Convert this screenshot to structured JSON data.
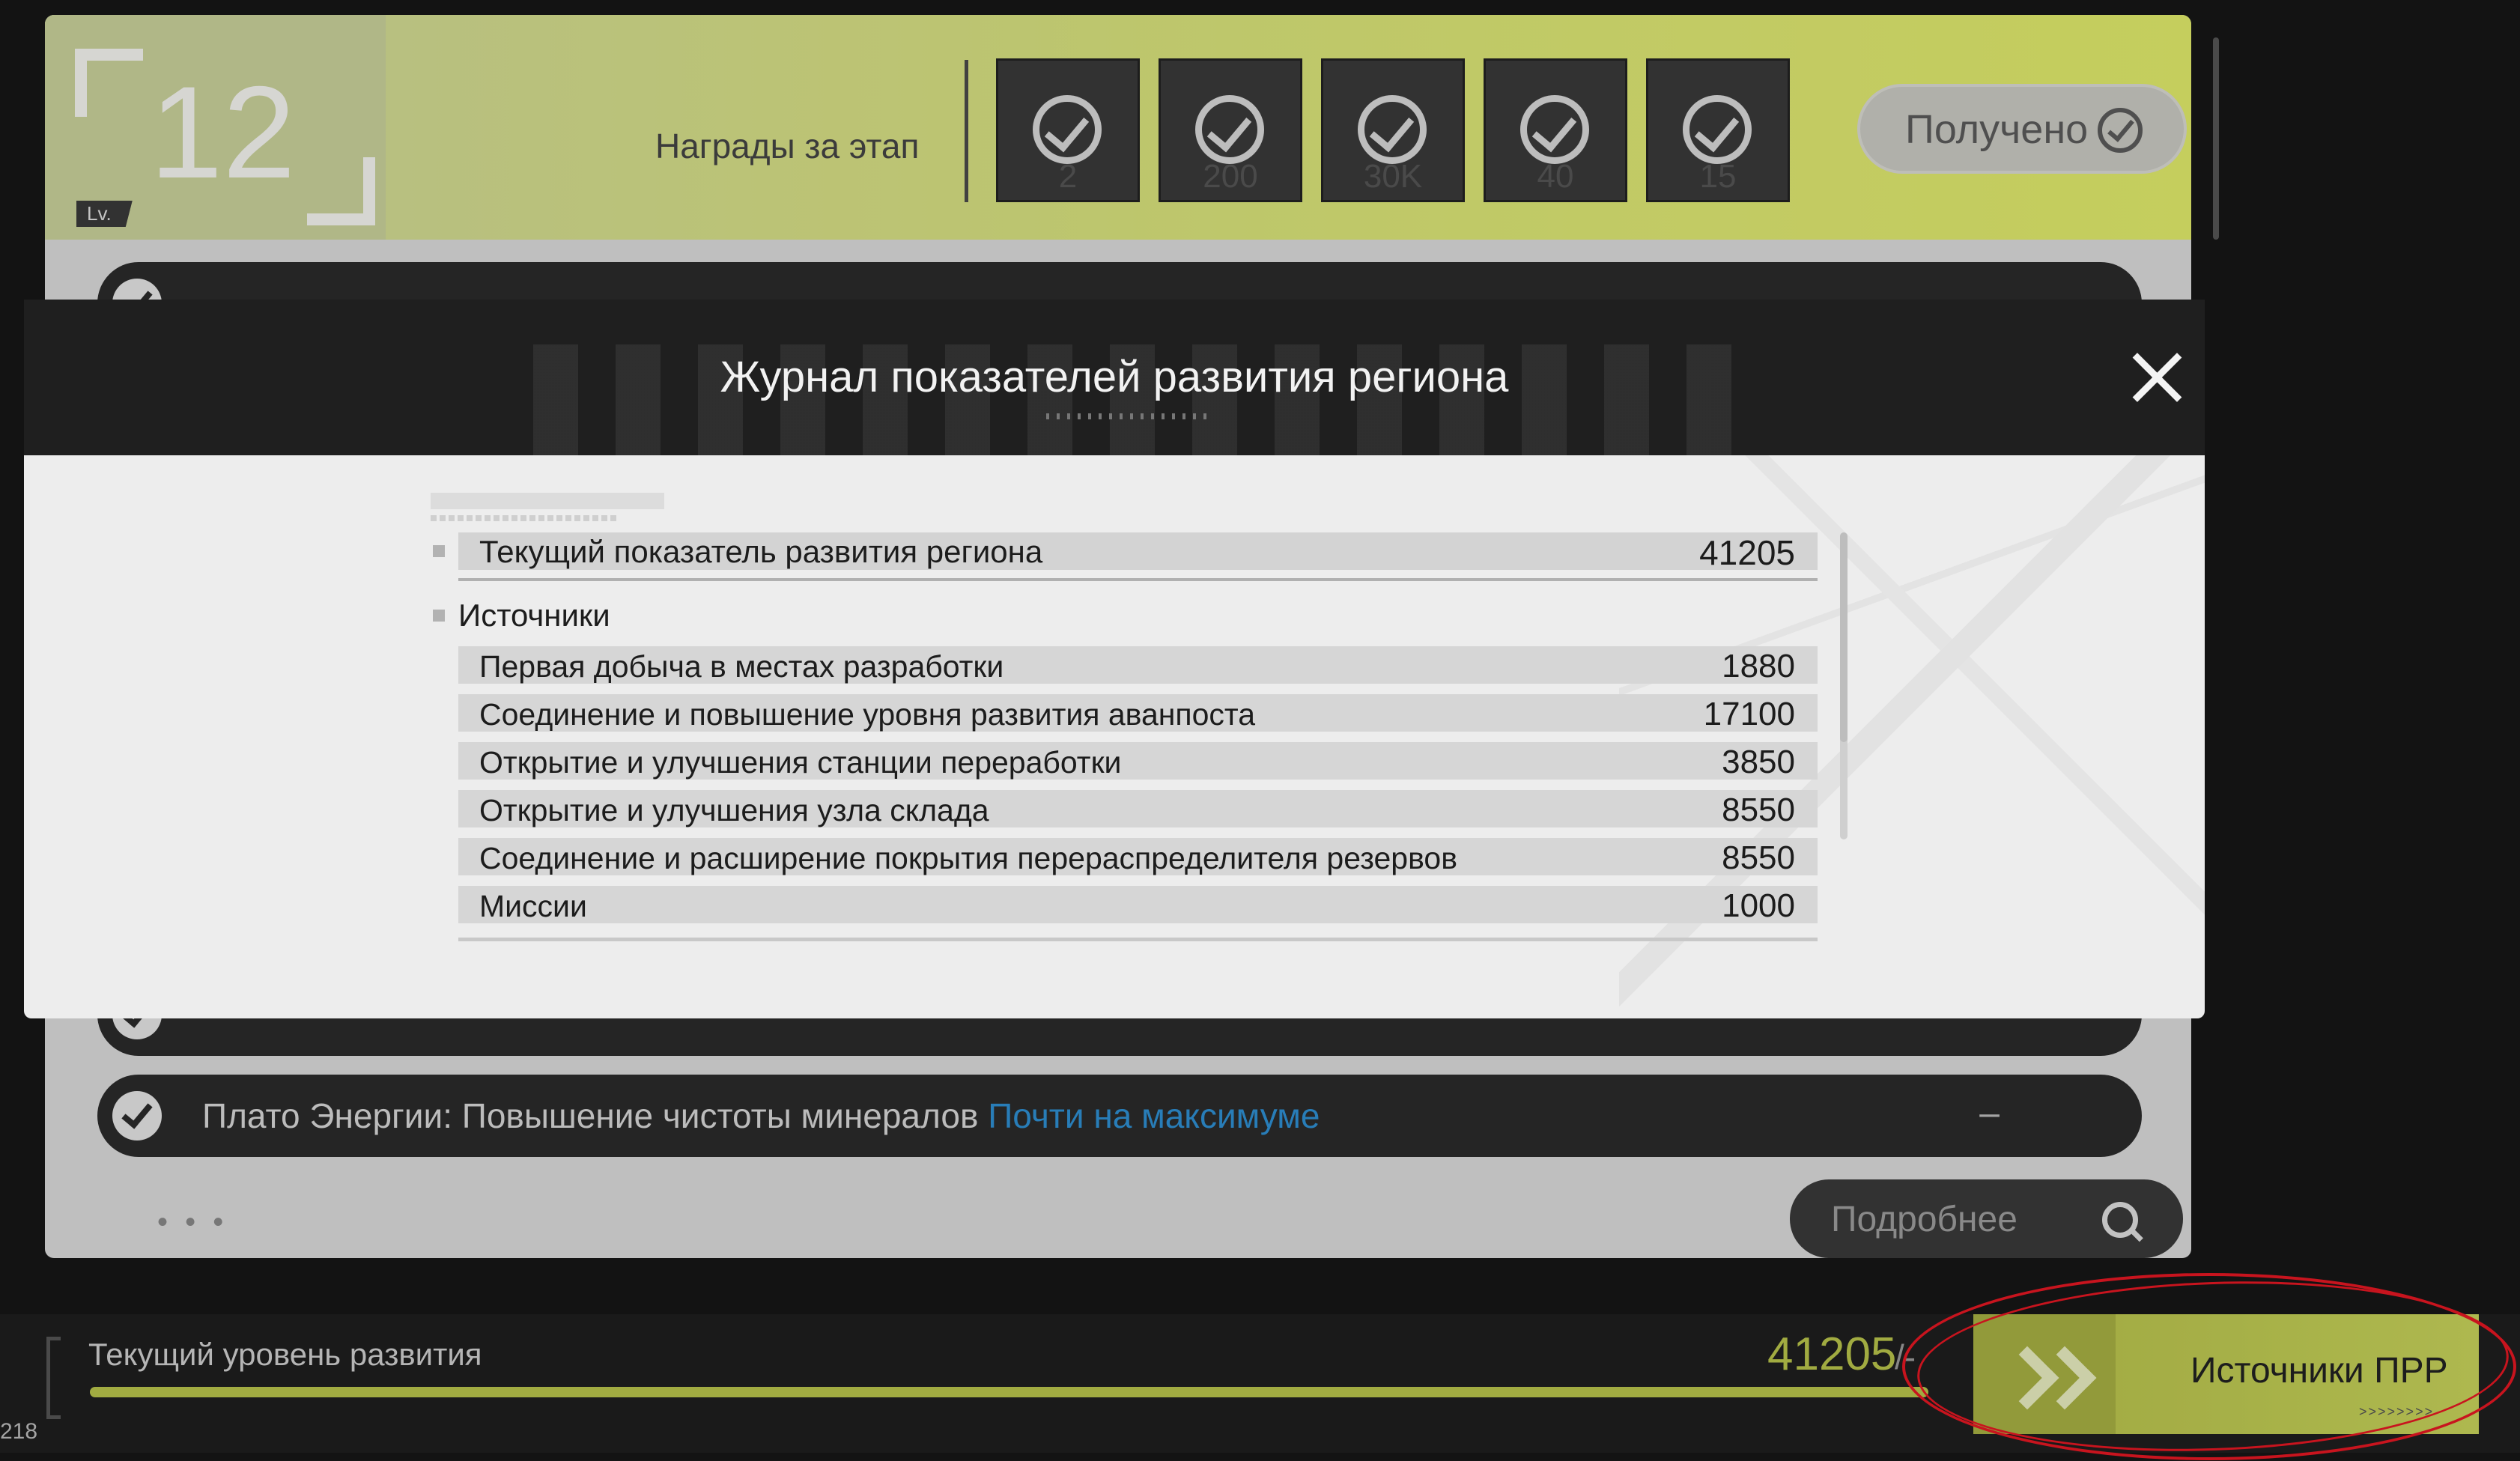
{
  "stage": {
    "level": "12",
    "level_tag": "Lv.",
    "rewards_label": "Награды за этап",
    "rewards": [
      {
        "qty": "2"
      },
      {
        "qty": "200"
      },
      {
        "qty": "30K"
      },
      {
        "qty": "40"
      },
      {
        "qty": "15"
      }
    ],
    "received_label": "Получено"
  },
  "missions": [
    {
      "text": "Плато Энергии: Повышение чистоты минералов",
      "status": "Почти на максимуме",
      "dash": "–"
    }
  ],
  "more_dots": "• • •",
  "details_label": "Подробнее",
  "bottom": {
    "dev_label": "Текущий уровень развития",
    "dev_value": "41205",
    "dev_max": "/-",
    "progress": 1.0,
    "sources_label": "Источники ПРР",
    "sources_tiny": ">>>>>>>>",
    "corner_num": "218"
  },
  "modal": {
    "title": "Журнал показателей развития региона",
    "current_label": "Текущий показатель развития региона",
    "current_value": "41205",
    "sources_heading": "Источники",
    "sources": [
      {
        "label": "Первая добыча в местах разработки",
        "value": "1880"
      },
      {
        "label": "Соединение и повышение уровня развития аванпоста",
        "value": "17100"
      },
      {
        "label": "Открытие и улучшения станции переработки",
        "value": "3850"
      },
      {
        "label": "Открытие и улучшения узла склада",
        "value": "8550"
      },
      {
        "label": "Соединение и расширение покрытия перераспределителя резервов",
        "value": "8550"
      },
      {
        "label": "Миссии",
        "value": "1000"
      }
    ]
  },
  "colors": {
    "accent": "#b8c34a",
    "status_blue": "#2e8fd2",
    "annotation_red": "#c8141e"
  }
}
